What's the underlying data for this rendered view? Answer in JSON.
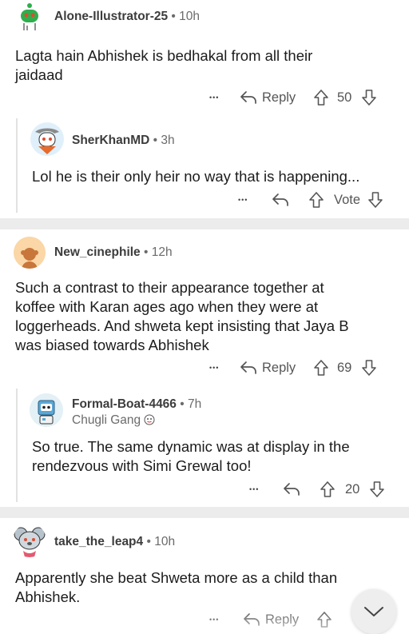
{
  "comments": [
    {
      "author": "Alone-Illustrator-25",
      "time": "10h",
      "body_lines": [
        "Lagta hain Abhishek is bedhakal from all their",
        "jaidaad"
      ],
      "reply_label": "Reply",
      "votes": "50",
      "avatar": "green-snoo-avatar"
    },
    {
      "author": "SherKhanMD",
      "time": "3h",
      "body_lines": [
        "Lol he is their only heir no way that is happening..."
      ],
      "votes": "Vote",
      "avatar": "cowboy-snoo-avatar"
    },
    {
      "author": "New_cinephile",
      "time": "12h",
      "body_lines": [
        "Such a contrast to their appearance together at",
        "koffee with Karan ages ago when they were at",
        "loggerheads. And shweta kept insisting that Jaya B",
        "was biased towards Abhishek"
      ],
      "reply_label": "Reply",
      "votes": "69",
      "avatar": "default-orange-avatar"
    },
    {
      "author": "Formal-Boat-4466",
      "time": "7h",
      "flair": "Chugli Gang",
      "body_lines": [
        "So true. The same dynamic was at display in the",
        "rendezvous with Simi Grewal too!"
      ],
      "votes": "20",
      "avatar": "robot-snoo-avatar"
    },
    {
      "author": "take_the_leap4",
      "time": "10h",
      "body_lines": [
        "Apparently she beat Shweta more as a child than",
        "Abhishek."
      ],
      "reply_label": "Reply",
      "avatar": "koala-snoo-avatar"
    }
  ],
  "sep": "•",
  "more": "•••",
  "icons": {
    "reply": "reply-arrow-icon",
    "upvote": "upvote-arrow-icon",
    "downvote": "downvote-arrow-icon",
    "more": "more-options-icon",
    "flair": "flair-emoji-icon",
    "collapse": "chevron-down-icon"
  },
  "colors": {
    "separator": "#ececec",
    "text": "#1c1c1c",
    "meta": "#6b6b6b"
  }
}
